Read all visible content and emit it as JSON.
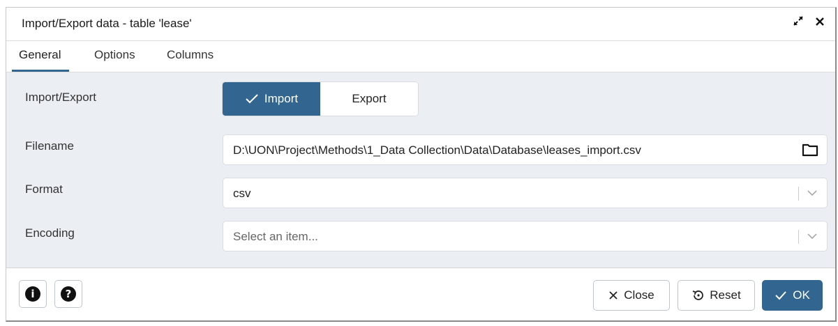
{
  "dialog": {
    "title": "Import/Export data - table 'lease'",
    "expand_icon": "expand-icon",
    "close_icon": "close-icon"
  },
  "tabs": [
    {
      "label": "General",
      "active": true
    },
    {
      "label": "Options",
      "active": false
    },
    {
      "label": "Columns",
      "active": false
    }
  ],
  "form": {
    "import_export": {
      "label": "Import/Export",
      "import_label": "Import",
      "export_label": "Export",
      "selected": "Import"
    },
    "filename": {
      "label": "Filename",
      "value": "D:\\UON\\Project\\Methods\\1_Data Collection\\Data\\Database\\leases_import.csv",
      "icon": "folder-icon"
    },
    "format": {
      "label": "Format",
      "value": "csv"
    },
    "encoding": {
      "label": "Encoding",
      "placeholder": "Select an item..."
    }
  },
  "footer": {
    "info_icon": "info-icon",
    "help_icon": "help-icon",
    "close_label": "Close",
    "reset_label": "Reset",
    "ok_label": "OK"
  },
  "colors": {
    "accent": "#326690",
    "form_background": "#ebeef3"
  }
}
